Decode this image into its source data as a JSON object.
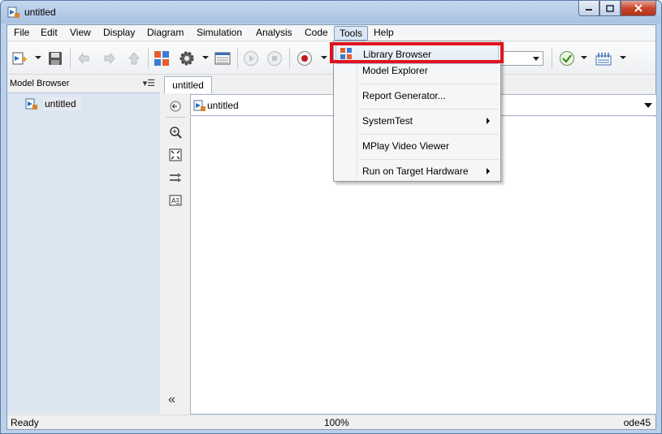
{
  "window": {
    "title": "untitled"
  },
  "menubar": {
    "items": [
      {
        "label": "File"
      },
      {
        "label": "Edit"
      },
      {
        "label": "View"
      },
      {
        "label": "Display"
      },
      {
        "label": "Diagram"
      },
      {
        "label": "Simulation"
      },
      {
        "label": "Analysis"
      },
      {
        "label": "Code"
      },
      {
        "label": "Tools"
      },
      {
        "label": "Help"
      }
    ],
    "open_menu": "Tools"
  },
  "tools_menu": {
    "items": [
      {
        "label": "Library Browser",
        "icon": "library-browser-icon",
        "highlighted": true,
        "submenu": false
      },
      {
        "label": "Model Explorer",
        "icon": "",
        "highlighted": false,
        "submenu": false
      },
      {
        "label": "Report Generator...",
        "icon": "",
        "highlighted": false,
        "submenu": false
      },
      {
        "label": "SystemTest",
        "icon": "",
        "highlighted": false,
        "submenu": true
      },
      {
        "label": "MPlay Video Viewer",
        "icon": "",
        "highlighted": false,
        "submenu": false
      },
      {
        "label": "Run on Target Hardware",
        "icon": "",
        "highlighted": false,
        "submenu": true
      }
    ]
  },
  "model_browser": {
    "title": "Model Browser",
    "tree": [
      {
        "label": "untitled"
      }
    ]
  },
  "tabs": [
    {
      "label": "untitled"
    }
  ],
  "explorer_bar": {
    "path": "untitled"
  },
  "statusbar": {
    "status": "Ready",
    "zoom": "100%",
    "solver": "ode45"
  },
  "colors": {
    "highlight_box": "#e0141e",
    "tree_background": "#dce6f1",
    "menu_hover": "#dce6f4"
  }
}
